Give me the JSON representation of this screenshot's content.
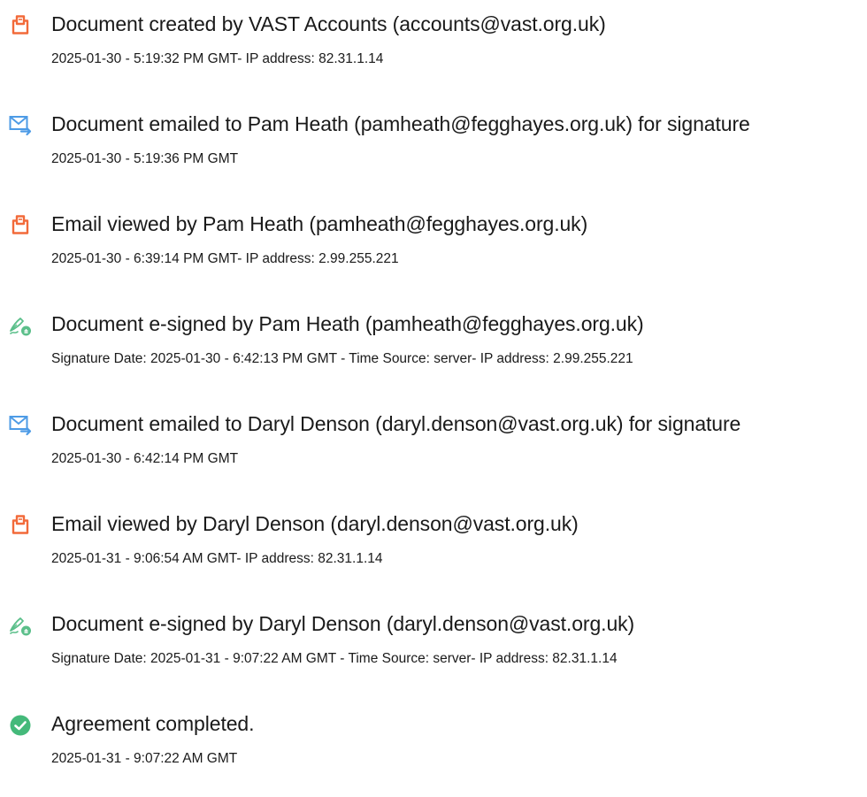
{
  "audit_events": [
    {
      "icon": "document-created-icon",
      "title": "Document created by VAST Accounts (accounts@vast.org.uk)",
      "detail": "2025-01-30 - 5:19:32 PM GMT- IP address: 82.31.1.14"
    },
    {
      "icon": "email-sent-icon",
      "title": "Document emailed to Pam Heath (pamheath@fegghayes.org.uk) for signature",
      "detail": "2025-01-30 - 5:19:36 PM GMT"
    },
    {
      "icon": "email-viewed-icon",
      "title": "Email viewed by Pam Heath (pamheath@fegghayes.org.uk)",
      "detail": "2025-01-30 - 6:39:14 PM GMT- IP address: 2.99.255.221"
    },
    {
      "icon": "e-signed-icon",
      "title": "Document e-signed by Pam Heath (pamheath@fegghayes.org.uk)",
      "detail": "Signature Date: 2025-01-30 - 6:42:13 PM GMT - Time Source: server- IP address: 2.99.255.221"
    },
    {
      "icon": "email-sent-icon",
      "title": "Document emailed to Daryl Denson (daryl.denson@vast.org.uk) for signature",
      "detail": "2025-01-30 - 6:42:14 PM GMT"
    },
    {
      "icon": "email-viewed-icon",
      "title": "Email viewed by Daryl Denson (daryl.denson@vast.org.uk)",
      "detail": "2025-01-31 - 9:06:54 AM GMT- IP address: 82.31.1.14"
    },
    {
      "icon": "e-signed-icon",
      "title": "Document e-signed by Daryl Denson (daryl.denson@vast.org.uk)",
      "detail": "Signature Date: 2025-01-31 - 9:07:22 AM GMT - Time Source: server- IP address: 82.31.1.14"
    },
    {
      "icon": "completed-check-icon",
      "title": "Agreement completed.",
      "detail": "2025-01-31 - 9:07:22 AM GMT"
    }
  ],
  "colors": {
    "document_icon": "#f26a3a",
    "email_icon": "#4d9be6",
    "signature_icon": "#5bbf8a",
    "completed_icon": "#44b97a",
    "text": "#1a1a1a"
  }
}
